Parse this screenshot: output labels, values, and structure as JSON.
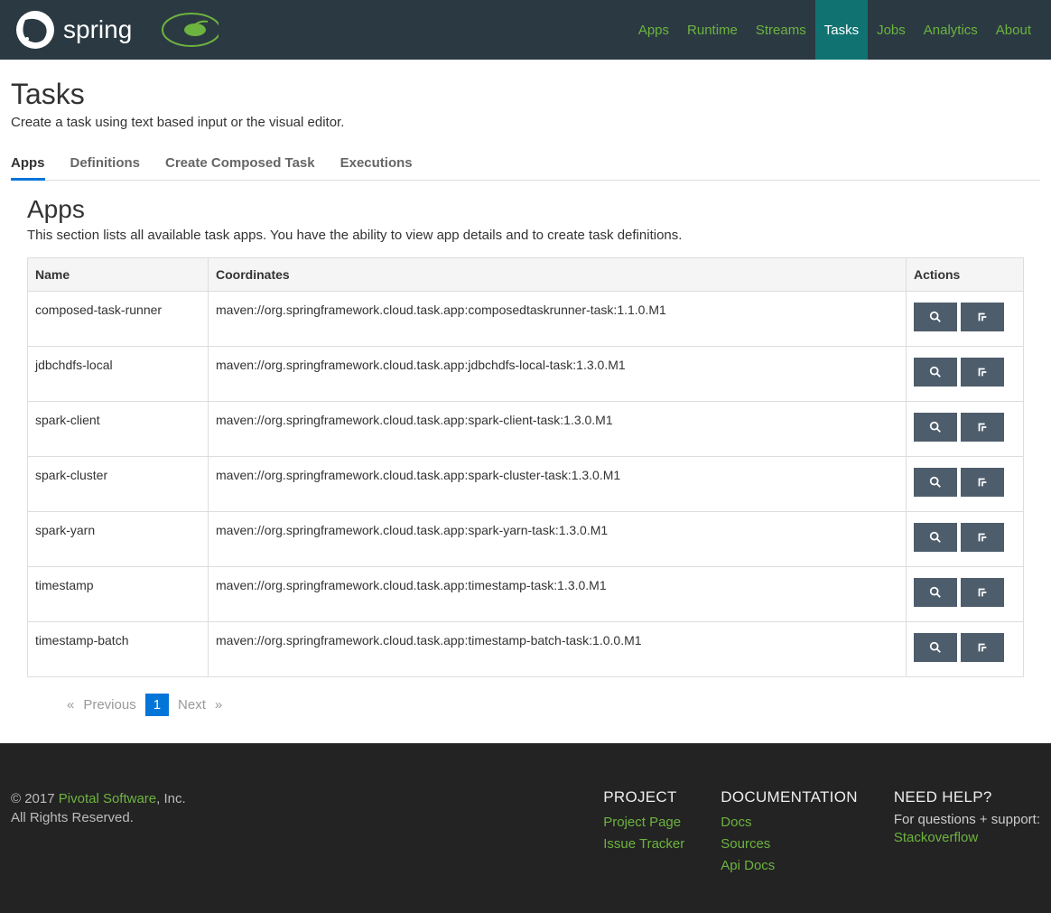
{
  "nav": {
    "items": [
      {
        "label": "Apps"
      },
      {
        "label": "Runtime"
      },
      {
        "label": "Streams"
      },
      {
        "label": "Tasks",
        "active": true
      },
      {
        "label": "Jobs"
      },
      {
        "label": "Analytics"
      },
      {
        "label": "About"
      }
    ]
  },
  "page": {
    "title": "Tasks",
    "subtitle": "Create a task using text based input or the visual editor."
  },
  "tabs": {
    "items": [
      {
        "label": "Apps",
        "active": true
      },
      {
        "label": "Definitions"
      },
      {
        "label": "Create Composed Task"
      },
      {
        "label": "Executions"
      }
    ]
  },
  "section": {
    "title": "Apps",
    "subtitle": "This section lists all available task apps. You have the ability to view app details and to create task definitions."
  },
  "table": {
    "headers": {
      "name": "Name",
      "coords": "Coordinates",
      "actions": "Actions"
    },
    "rows": [
      {
        "name": "composed-task-runner",
        "coords": "maven://org.springframework.cloud.task.app:composedtaskrunner-task:1.1.0.M1"
      },
      {
        "name": "jdbchdfs-local",
        "coords": "maven://org.springframework.cloud.task.app:jdbchdfs-local-task:1.3.0.M1"
      },
      {
        "name": "spark-client",
        "coords": "maven://org.springframework.cloud.task.app:spark-client-task:1.3.0.M1"
      },
      {
        "name": "spark-cluster",
        "coords": "maven://org.springframework.cloud.task.app:spark-cluster-task:1.3.0.M1"
      },
      {
        "name": "spark-yarn",
        "coords": "maven://org.springframework.cloud.task.app:spark-yarn-task:1.3.0.M1"
      },
      {
        "name": "timestamp",
        "coords": "maven://org.springframework.cloud.task.app:timestamp-task:1.3.0.M1"
      },
      {
        "name": "timestamp-batch",
        "coords": "maven://org.springframework.cloud.task.app:timestamp-batch-task:1.0.0.M1"
      }
    ]
  },
  "pagination": {
    "prev": "Previous",
    "next": "Next",
    "page": "1"
  },
  "footer": {
    "copyright_prefix": "© 2017 ",
    "pivotal": "Pivotal Software",
    "copyright_suffix": ", Inc.",
    "rights": "All Rights Reserved.",
    "project": {
      "title": "PROJECT",
      "links": [
        "Project Page",
        "Issue Tracker"
      ]
    },
    "docs": {
      "title": "DOCUMENTATION",
      "links": [
        "Docs",
        "Sources",
        "Api Docs"
      ]
    },
    "help": {
      "title": "NEED HELP?",
      "text": "For questions + support:",
      "link": "Stackoverflow"
    }
  }
}
